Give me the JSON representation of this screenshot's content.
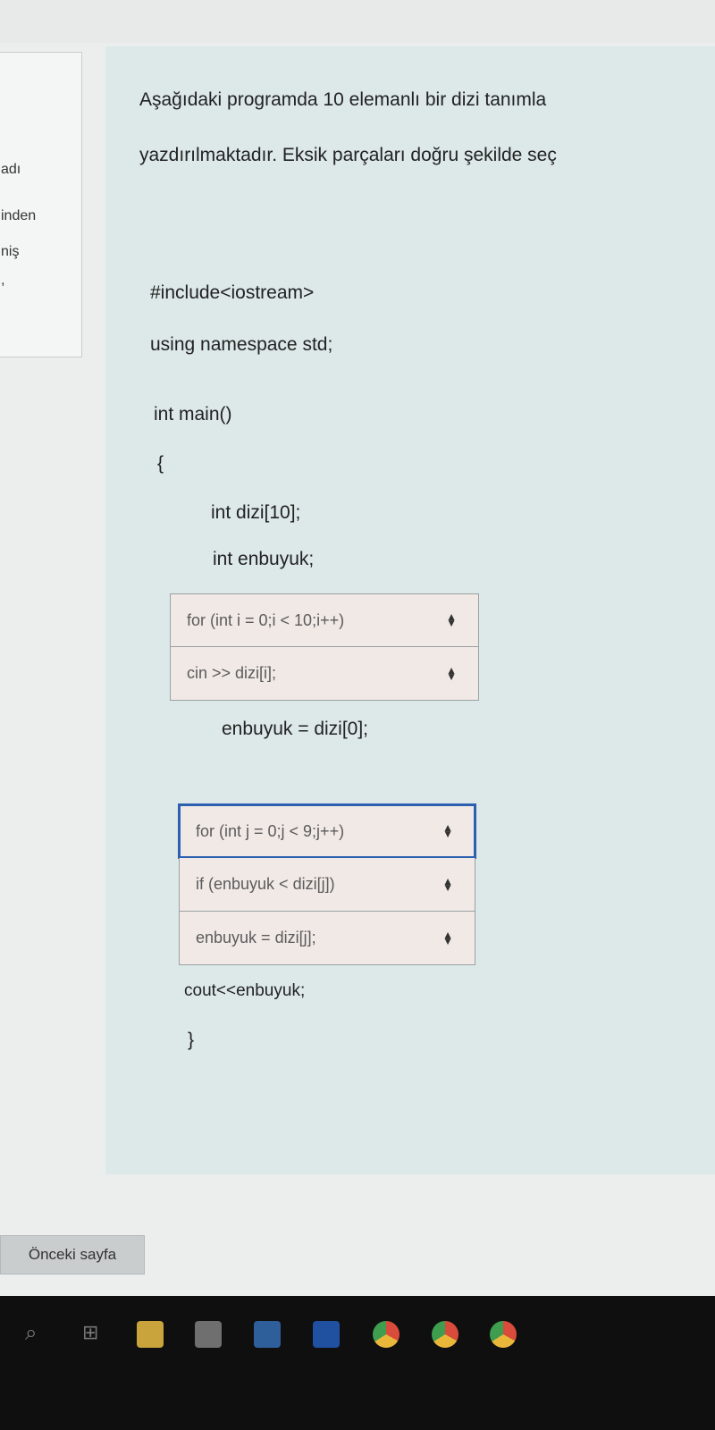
{
  "sidebar": {
    "fragments": [
      "adı",
      "inden",
      "niş",
      ","
    ]
  },
  "question": {
    "line1": "Aşağıdaki programda 10 elemanlı bir dizi tanımla",
    "line2": "yazdırılmaktadır. Eksik parçaları doğru şekilde seç"
  },
  "code": {
    "include": "#include<iostream>",
    "namespace": "using namespace std;",
    "main": "int main()",
    "open_brace": "{",
    "decl_array": "int dizi[10];",
    "decl_max": "int enbuyuk;",
    "assign_first": "enbuyuk = dizi[0];",
    "cout": "cout<<enbuyuk;",
    "close_brace": "}"
  },
  "selects": {
    "group1": [
      "for (int i = 0;i < 10;i++)",
      "cin >> dizi[i];"
    ],
    "group2": [
      "for (int j = 0;j < 9;j++)",
      "if (enbuyuk < dizi[j])",
      "enbuyuk = dizi[j];"
    ]
  },
  "nav": {
    "prev_label": "Önceki sayfa"
  },
  "taskbar": {
    "icons": [
      "search-icon",
      "task-view-icon",
      "file-explorer-icon",
      "store-icon",
      "mail-icon",
      "app-icon",
      "chrome-icon",
      "chrome-icon",
      "chrome-icon"
    ]
  },
  "colors": {
    "card_bg": "#dde8e8",
    "select_bg": "#f1e9e6",
    "focus_outline": "#2c5fb0",
    "taskbar_bg": "#0f0f10"
  }
}
